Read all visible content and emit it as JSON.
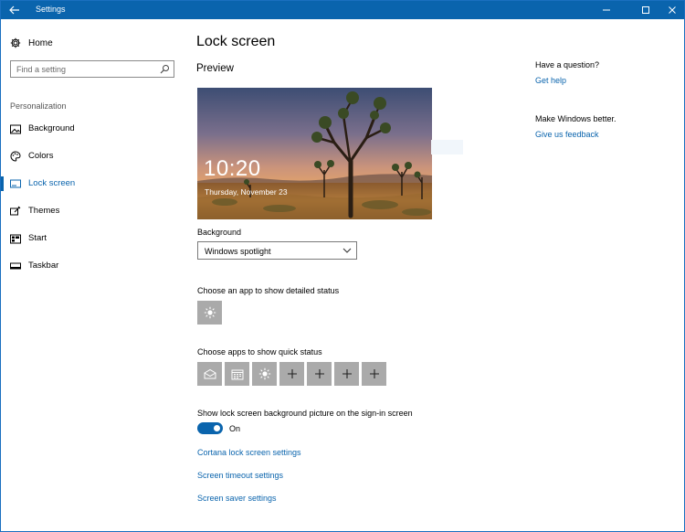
{
  "window": {
    "title": "Settings"
  },
  "sidebar": {
    "home_label": "Home",
    "search_placeholder": "Find a setting",
    "section_label": "Personalization",
    "items": [
      {
        "label": "Background",
        "icon": "image-icon"
      },
      {
        "label": "Colors",
        "icon": "palette-icon"
      },
      {
        "label": "Lock screen",
        "icon": "lock-screen-icon",
        "active": true
      },
      {
        "label": "Themes",
        "icon": "brush-icon"
      },
      {
        "label": "Start",
        "icon": "start-icon"
      },
      {
        "label": "Taskbar",
        "icon": "taskbar-icon"
      }
    ]
  },
  "main": {
    "title": "Lock screen",
    "preview_label": "Preview",
    "preview_time": "10:20",
    "preview_date": "Thursday, November 23",
    "background_label": "Background",
    "background_value": "Windows spotlight",
    "detailed_status_label": "Choose an app to show detailed status",
    "quick_status_label": "Choose apps to show quick status",
    "quick_status_apps": [
      "mail-icon",
      "calendar-icon",
      "weather-icon",
      "add-icon",
      "add-icon",
      "add-icon",
      "add-icon"
    ],
    "signin_label": "Show lock screen background picture on the sign-in screen",
    "toggle_state": "On",
    "links": {
      "cortana": "Cortana lock screen settings",
      "timeout": "Screen timeout settings",
      "saver": "Screen saver settings"
    }
  },
  "aside": {
    "question_heading": "Have a question?",
    "help_link": "Get help",
    "better_heading": "Make Windows better.",
    "feedback_link": "Give us feedback"
  },
  "colors": {
    "accent": "#0a64ad",
    "tile": "#aaaaaa"
  }
}
